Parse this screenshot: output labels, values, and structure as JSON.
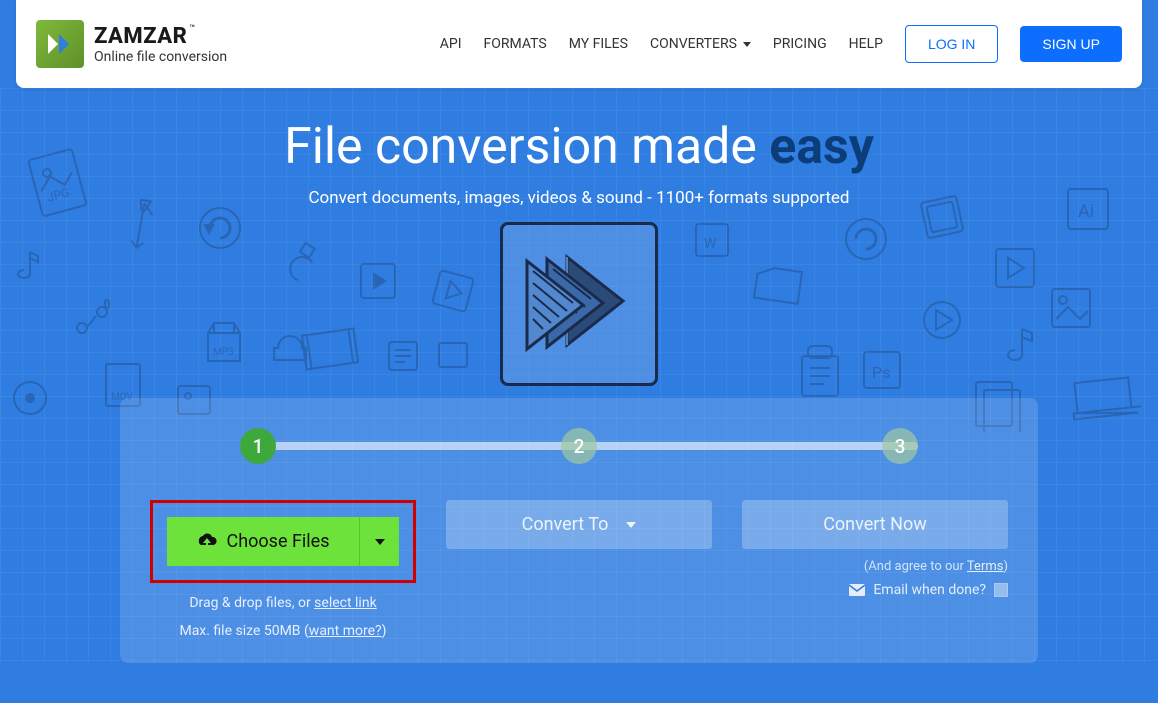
{
  "brand": {
    "name": "ZAMZAR",
    "tagline": "Online file conversion",
    "trademark": "™"
  },
  "nav": {
    "items": [
      "API",
      "FORMATS",
      "MY FILES",
      "CONVERTERS",
      "PRICING",
      "HELP"
    ],
    "login": "LOG IN",
    "signup": "SIGN UP"
  },
  "hero": {
    "title_pre": "File conversion made ",
    "title_em": "easy",
    "subtitle": "Convert documents, images, videos & sound - 1100+ formats supported"
  },
  "steps": [
    "1",
    "2",
    "3"
  ],
  "step1": {
    "choose": "Choose Files",
    "hint1_pre": "Drag & drop files, or ",
    "hint1_link": "select link",
    "hint2_pre": "Max. file size 50MB (",
    "hint2_link": "want more?",
    "hint2_post": ")"
  },
  "step2": {
    "label": "Convert To"
  },
  "step3": {
    "label": "Convert Now",
    "agree_pre": "(And agree to our ",
    "agree_link": "Terms",
    "agree_post": ")",
    "email_label": "Email when done?"
  },
  "colors": {
    "primary_blue": "#2f7de0",
    "accent_green": "#6de23a",
    "highlight_red": "#d10000",
    "button_blue": "#0d6efd"
  }
}
